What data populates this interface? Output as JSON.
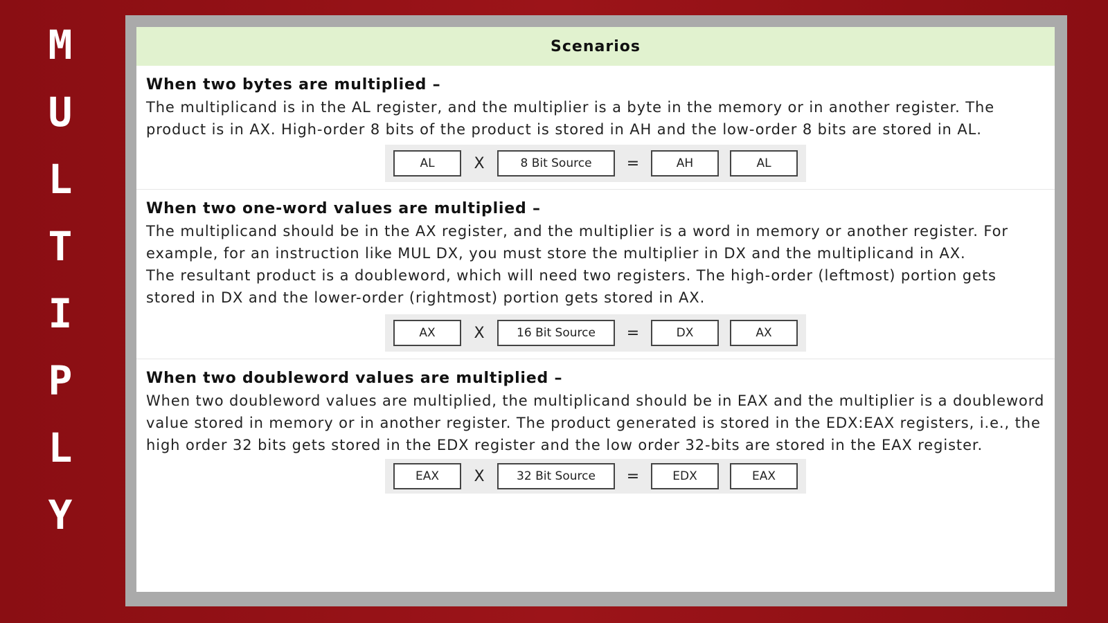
{
  "side_title": [
    "M",
    "U",
    "L",
    "T",
    "I",
    "P",
    "L",
    "Y"
  ],
  "header": {
    "title": "Scenarios"
  },
  "sections": [
    {
      "heading": "When two bytes are multiplied –",
      "paragraphs": [
        "The multiplicand is in the AL register, and the multiplier is a byte in the memory or in another register. The product is in AX. High-order 8 bits of the product is stored in AH and the low-order 8 bits are stored in AL."
      ],
      "formula": {
        "operand1": "AL",
        "times": "X",
        "operand2": "8 Bit Source",
        "equals": "=",
        "result_high": "AH",
        "result_low": "AL"
      }
    },
    {
      "heading": "When two one-word values are multiplied –",
      "paragraphs": [
        "The multiplicand should be in the AX register, and the multiplier is a word in memory or another register. For example, for an instruction like MUL DX, you must store the multiplier in DX and the multiplicand in AX.",
        "The resultant product is a doubleword, which will need two registers. The high-order (leftmost) portion gets stored in DX and the lower-order (rightmost) portion gets stored in AX."
      ],
      "formula": {
        "operand1": "AX",
        "times": "X",
        "operand2": "16 Bit Source",
        "equals": "=",
        "result_high": "DX",
        "result_low": "AX"
      }
    },
    {
      "heading": "When two doubleword values are multiplied –",
      "paragraphs": [
        "When two doubleword values are multiplied, the multiplicand should be in EAX and the multiplier is a doubleword value stored in memory or in another register. The product generated is stored in the EDX:EAX registers, i.e., the high order 32 bits gets stored in the EDX register and the low order 32-bits are stored in the EAX register."
      ],
      "formula": {
        "operand1": "EAX",
        "times": "X",
        "operand2": "32 Bit Source",
        "equals": "=",
        "result_high": "EDX",
        "result_low": "EAX"
      }
    }
  ]
}
